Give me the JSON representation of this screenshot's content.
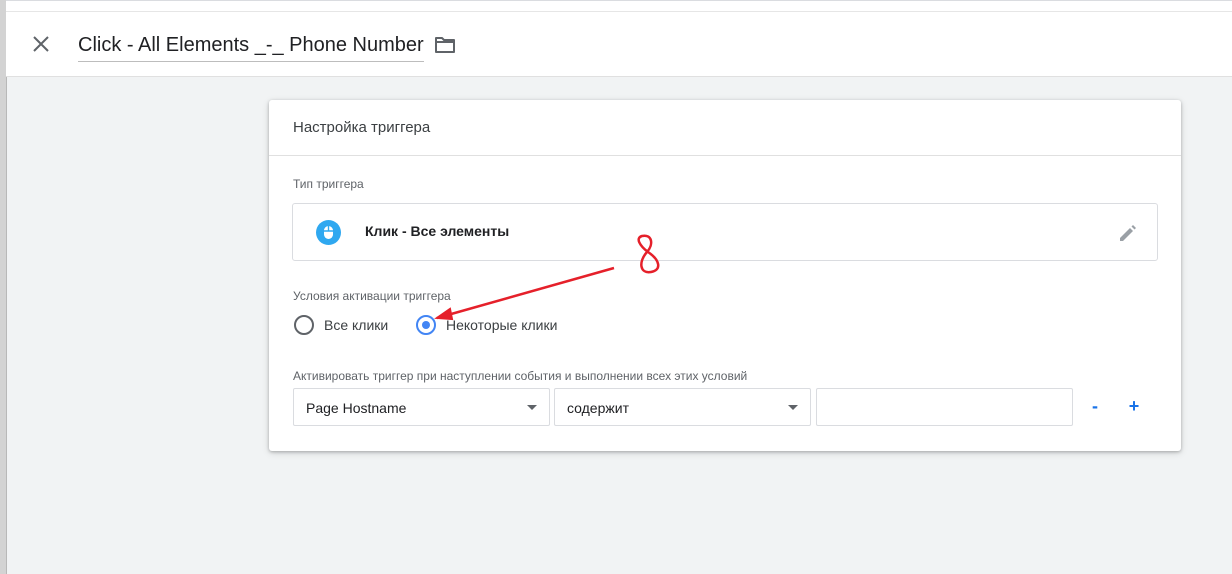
{
  "header": {
    "title": "Click - All Elements _-_ Phone Number",
    "close_icon": "close-icon",
    "folder_icon": "folder-icon"
  },
  "card": {
    "title": "Настройка триггера",
    "trigger_type_label": "Тип триггера",
    "trigger_type": {
      "icon": "mouse-icon",
      "icon_color": "#2fa8f0",
      "name": "Клик - Все элементы",
      "edit_icon": "pencil-icon"
    },
    "activation_label": "Условия активации триггера",
    "radio_options": [
      {
        "label": "Все клики",
        "checked": false
      },
      {
        "label": "Некоторые клики",
        "checked": true
      }
    ],
    "condition_label": "Активировать триггер при наступлении события и выполнении всех этих условий",
    "condition": {
      "variable": "Page Hostname",
      "operator": "содержит",
      "value": ""
    },
    "minus_label": "-",
    "plus_label": "+"
  },
  "annotation": {
    "text": "8",
    "color": "#e5202a"
  },
  "colors": {
    "accent": "#4285f4",
    "link": "#1a73e8",
    "background": "#f1f3f4"
  }
}
